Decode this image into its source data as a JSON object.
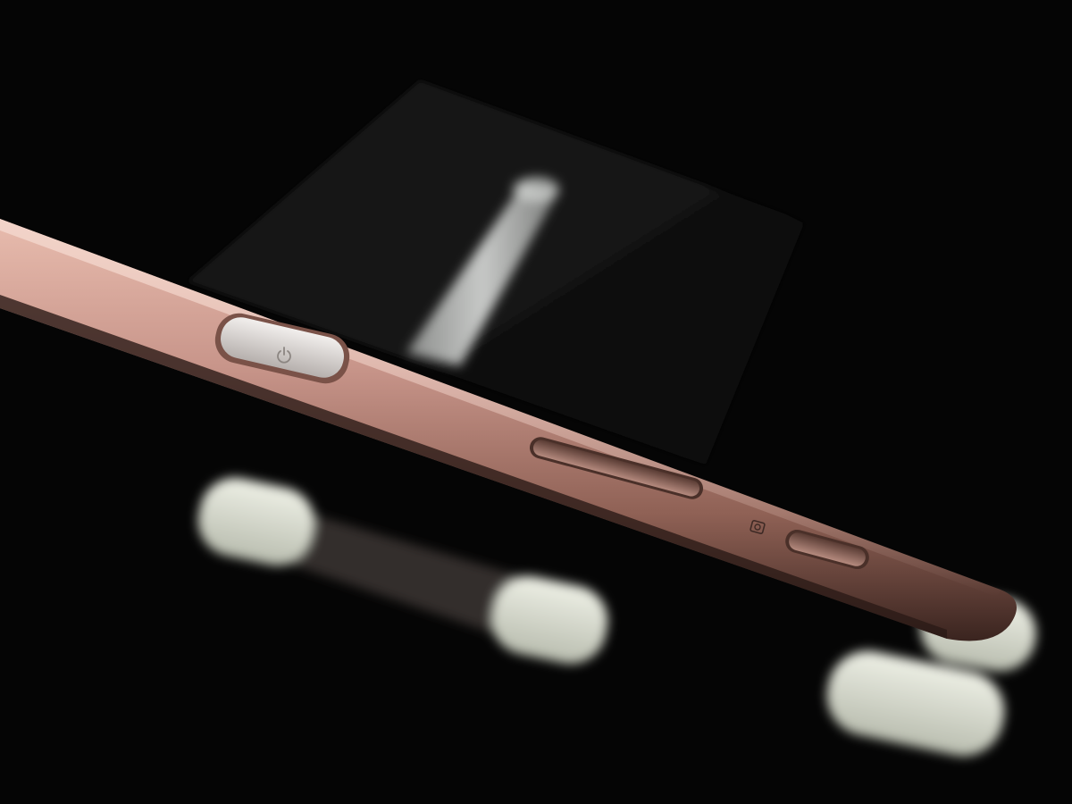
{
  "photo": {
    "subject": "phone-side-profile",
    "frame_finish": "rose-gold",
    "colors": {
      "background": "#050505",
      "frame_highlight": "#d9a99a",
      "frame_mid": "#a8786b",
      "frame_shadow": "#4a3029",
      "button_face": "#cfcac7",
      "stand_cap": "#d8ddd0",
      "stand_block": "#151515"
    },
    "buttons": [
      {
        "name": "power-button",
        "icon": "power-icon"
      },
      {
        "name": "volume-rocker"
      },
      {
        "name": "camera-button",
        "icon": "camera-icon"
      }
    ]
  }
}
